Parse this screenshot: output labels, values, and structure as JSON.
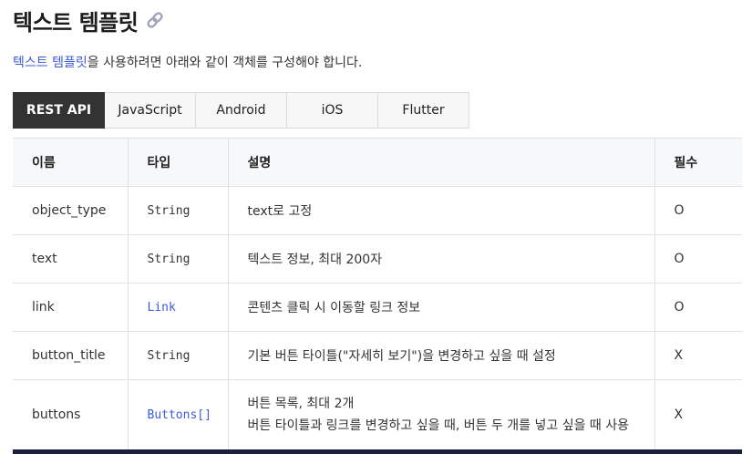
{
  "header": {
    "title": "텍스트 템플릿"
  },
  "intro": {
    "highlight": "텍스트 템플릿",
    "rest": "을 사용하려면 아래와 같이 객체를 구성해야 합니다."
  },
  "tabs": [
    {
      "label": "REST API"
    },
    {
      "label": "JavaScript"
    },
    {
      "label": "Android"
    },
    {
      "label": "iOS"
    },
    {
      "label": "Flutter"
    }
  ],
  "table": {
    "headers": [
      "이름",
      "타입",
      "설명",
      "필수"
    ],
    "rows": [
      {
        "name": "object_type",
        "type": "String",
        "desc": "text로 고정",
        "desc2": "",
        "required": "O"
      },
      {
        "name": "text",
        "type": "String",
        "desc": "텍스트 정보, 최대 200자",
        "desc2": "",
        "required": "O"
      },
      {
        "name": "link",
        "type": "Link",
        "desc": "콘텐츠 클릭 시 이동할 링크 정보",
        "desc2": "",
        "required": "O"
      },
      {
        "name": "button_title",
        "type": "String",
        "desc": "기본 버튼 타이틀(\"자세히 보기\")을 변경하고 싶을 때 설정",
        "desc2": "",
        "required": "X"
      },
      {
        "name": "buttons",
        "type": "Buttons[]",
        "desc": "버튼 목록, 최대 2개",
        "desc2": "버튼 타이틀과 링크를 변경하고 싶을 때, 버튼 두 개를 넣고 싶을 때 사용",
        "required": "X"
      }
    ]
  },
  "icons": {
    "title_icon": "link-icon"
  },
  "colors": {
    "accent": "#3b5bdb",
    "active_tab": "#333333",
    "header_bg": "#f7f8fa"
  }
}
